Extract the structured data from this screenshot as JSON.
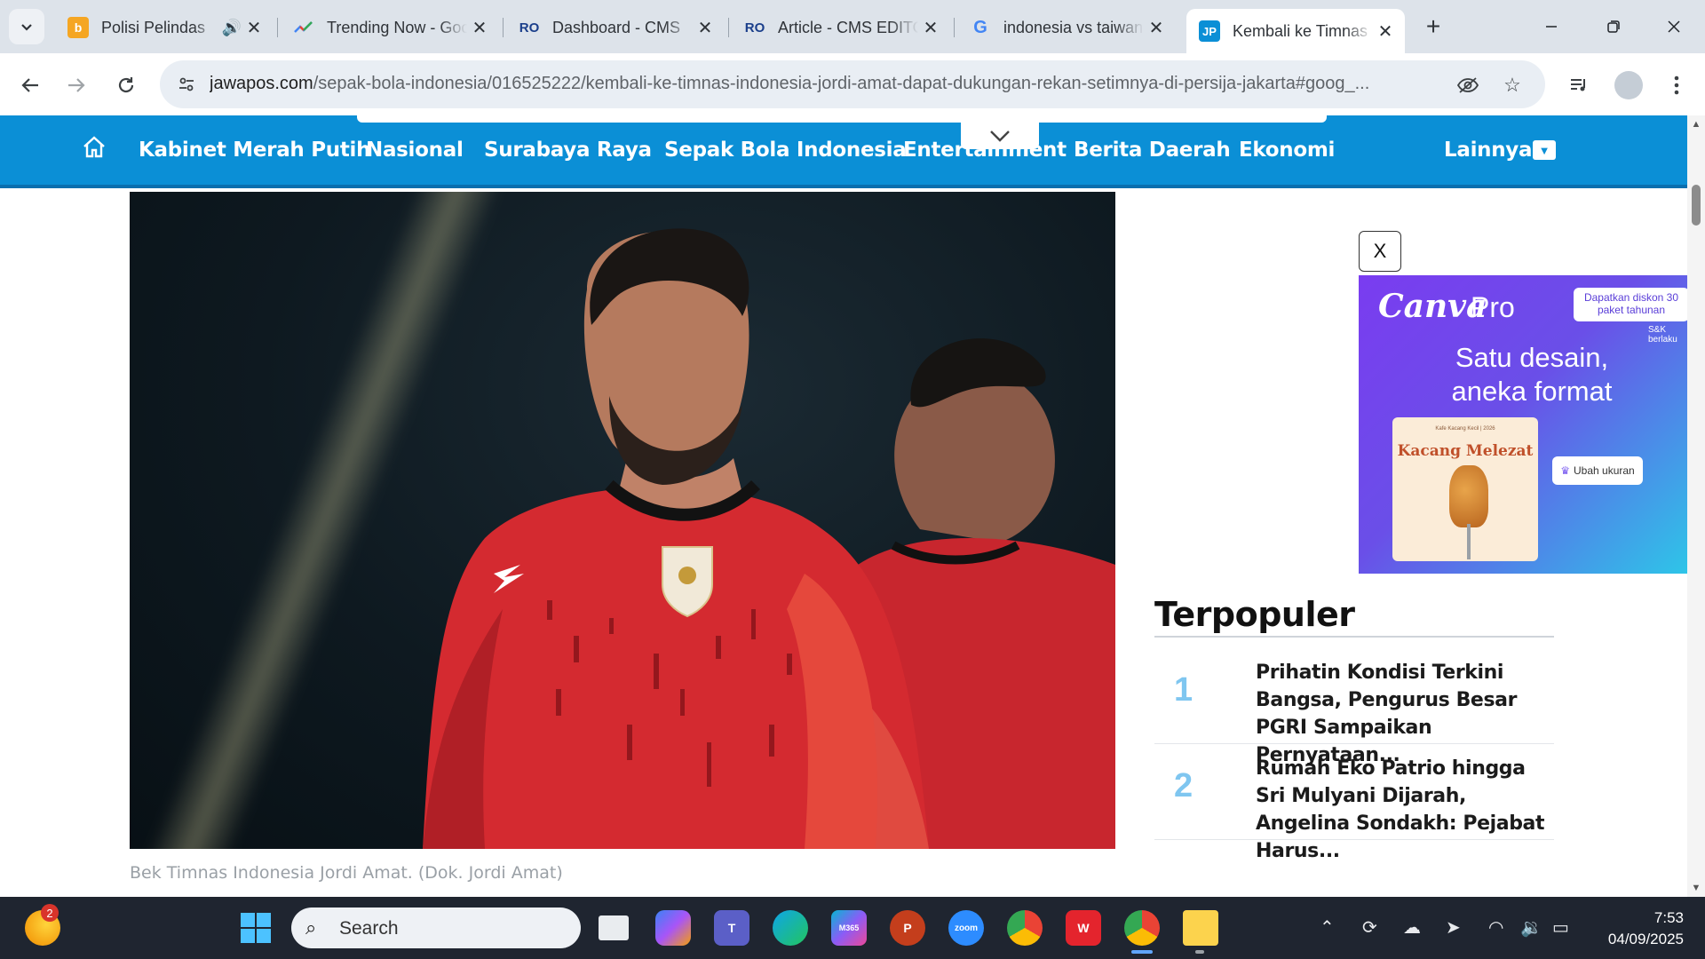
{
  "browser": {
    "tabs": [
      {
        "title": "Polisi Pelindas",
        "favicon": "bing-b-icon",
        "audio": true,
        "active": false
      },
      {
        "title": "Trending Now - Google Trends",
        "favicon": "trends-icon",
        "audio": false,
        "active": false
      },
      {
        "title": "Dashboard - CMS",
        "favicon": "cms-ro-icon",
        "audio": false,
        "active": false
      },
      {
        "title": "Article - CMS EDITOR",
        "favicon": "cms-ro-icon",
        "audio": false,
        "active": false
      },
      {
        "title": "indonesia vs taiwan",
        "favicon": "google-g-icon",
        "audio": false,
        "active": false
      },
      {
        "title": "Kembali ke Timnas",
        "favicon": "jawapos-jp-icon",
        "audio": false,
        "active": true
      }
    ],
    "url_domain": "jawapos.com",
    "url_path": "/sepak-bola-indonesia/016525222/kembali-ke-timnas-indonesia-jordi-amat-dapat-dukungan-rekan-setimnya-di-persija-jakarta#goog_..."
  },
  "site": {
    "nav": [
      "Kabinet Merah Putih",
      "Nasional",
      "Surabaya Raya",
      "Sepak Bola Indonesia",
      "Entertainment",
      "Berita Daerah",
      "Ekonomi"
    ],
    "more_label": "Lainnya",
    "accent": "#0b8fd6"
  },
  "article": {
    "image_alt": "Bek Timnas Indonesia Jordi Amat",
    "caption": "Bek Timnas Indonesia Jordi Amat. (Dok. Jordi Amat)"
  },
  "ad": {
    "close_label": "X",
    "brand": "Canva",
    "brand_suffix": "Pro",
    "promo": "Dapatkan diskon 30 paket tahunan",
    "terms": "S&K berlaku",
    "headline_line1": "Satu desain,",
    "headline_line2": "aneka format",
    "card_title": "Kacang Melezat",
    "card_sub": "Kafe Kacang Kecil | 2026",
    "resize_label": "Ubah ukuran"
  },
  "popular": {
    "title": "Terpopuler",
    "items": [
      {
        "rank": "1",
        "text": "Prihatin Kondisi Terkini Bangsa, Pengurus Besar PGRI Sampaikan Pernyataan..."
      },
      {
        "rank": "2",
        "text": "Rumah Eko Patrio hingga Sri Mulyani Dijarah, Angelina Sondakh: Pejabat Harus..."
      }
    ]
  },
  "taskbar": {
    "search_placeholder": "Search",
    "weather_badge": "2",
    "time": "7:53",
    "date": "04/09/2025"
  }
}
